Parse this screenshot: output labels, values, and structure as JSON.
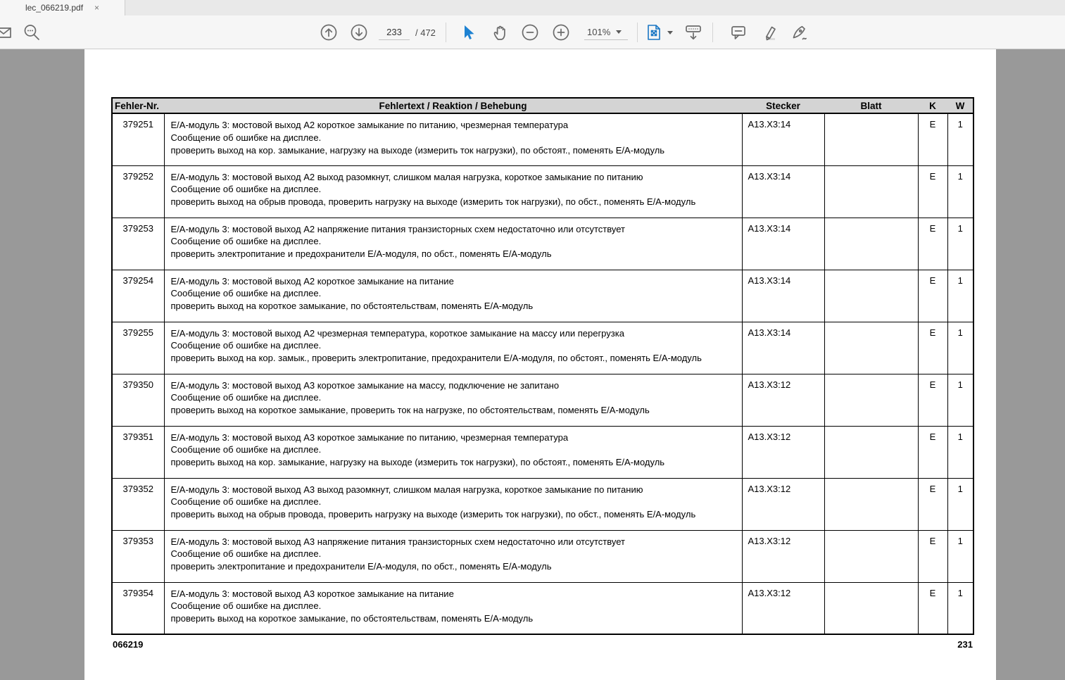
{
  "tab": {
    "title": "lec_066219.pdf",
    "close_glyph": "×"
  },
  "toolbar": {
    "page_current": "233",
    "page_total_label": "/ 472",
    "zoom_level": "101%",
    "icons": [
      "envelope-icon",
      "search-icon",
      "page-up-icon",
      "page-down-icon",
      "select-tool-icon",
      "hand-tool-icon",
      "zoom-out-icon",
      "zoom-in-icon",
      "page-fit-icon",
      "chevron-down-icon",
      "hide-toolbar-icon",
      "comment-icon",
      "highlighter-icon",
      "signature-pen-icon"
    ],
    "accent_color": "#1a77c4"
  },
  "document": {
    "table": {
      "headers": [
        "Fehler-Nr.",
        "Fehlertext / Reaktion / Behebung",
        "Stecker",
        "Blatt",
        "K",
        "W"
      ],
      "rows": [
        {
          "nr": "379251",
          "l1": "Е/А-модуль 3: мостовой выход А2 короткое замыкание по питанию, чрезмерная температура",
          "l2": "Сообщение об ошибке на дисплее.",
          "l3": "проверить выход на кор. замыкание, нагрузку на выходе (измерить ток нагрузки), по обстоят., поменять Е/А-модуль",
          "stecker": "A13.X3:14",
          "blatt": "",
          "k": "E",
          "w": "1"
        },
        {
          "nr": "379252",
          "l1": "Е/А-модуль 3: мостовой выход А2 выход разомкнут, слишком малая нагрузка, короткое замыкание по питанию",
          "l2": "Сообщение об ошибке на дисплее.",
          "l3": "проверить выход на обрыв провода, проверить нагрузку на выходе (измерить ток нагрузки), по обст., поменять Е/А-модуль",
          "stecker": "A13.X3:14",
          "blatt": "",
          "k": "E",
          "w": "1"
        },
        {
          "nr": "379253",
          "l1": "Е/А-модуль 3: мостовой выход А2 напряжение питания транзисторных схем недостаточно или отсутствует",
          "l2": "Сообщение об ошибке на дисплее.",
          "l3": "проверить электропитание и предохранители Е/А-модуля, по обст., поменять Е/А-модуль",
          "stecker": "A13.X3:14",
          "blatt": "",
          "k": "E",
          "w": "1"
        },
        {
          "nr": "379254",
          "l1": "Е/А-модуль 3: мостовой выход А2 короткое замыкание на питание",
          "l2": "Сообщение об ошибке на дисплее.",
          "l3": "проверить выход на короткое замыкание, по обстоятельствам, поменять Е/А-модуль",
          "stecker": "A13.X3:14",
          "blatt": "",
          "k": "E",
          "w": "1"
        },
        {
          "nr": "379255",
          "l1": "Е/А-модуль 3: мостовой выход А2 чрезмерная температура, короткое замыкание на массу или перегрузка",
          "l2": "Сообщение об ошибке на дисплее.",
          "l3": "проверить выход на кор. замык., проверить электропитание, предохранители Е/А-модуля, по обстоят., поменять Е/А-модуль",
          "stecker": "A13.X3:14",
          "blatt": "",
          "k": "E",
          "w": "1"
        },
        {
          "nr": "379350",
          "l1": "Е/А-модуль 3: мостовой выход А3 короткое замыкание на массу, подключение не запитано",
          "l2": "Сообщение об ошибке на дисплее.",
          "l3": "проверить выход на короткое замыкание, проверить ток на нагрузке, по обстоятельствам, поменять Е/А-модуль",
          "stecker": "A13.X3:12",
          "blatt": "",
          "k": "E",
          "w": "1"
        },
        {
          "nr": "379351",
          "l1": "Е/А-модуль 3: мостовой выход А3 короткое замыкание по питанию, чрезмерная температура",
          "l2": "Сообщение об ошибке на дисплее.",
          "l3": "проверить выход на кор. замыкание, нагрузку на выходе (измерить ток нагрузки), по обстоят., поменять Е/А-модуль",
          "stecker": "A13.X3:12",
          "blatt": "",
          "k": "E",
          "w": "1"
        },
        {
          "nr": "379352",
          "l1": "Е/А-модуль 3: мостовой выход А3 выход разомкнут, слишком малая нагрузка, короткое замыкание по питанию",
          "l2": "Сообщение об ошибке на дисплее.",
          "l3": "проверить выход на обрыв провода, проверить нагрузку на выходе (измерить ток нагрузки), по обст., поменять Е/А-модуль",
          "stecker": "A13.X3:12",
          "blatt": "",
          "k": "E",
          "w": "1"
        },
        {
          "nr": "379353",
          "l1": "Е/А-модуль 3: мостовой выход А3 напряжение питания транзисторных схем недостаточно или отсутствует",
          "l2": "Сообщение об ошибке на дисплее.",
          "l3": "проверить электропитание и предохранители Е/А-модуля, по обст., поменять Е/А-модуль",
          "stecker": "A13.X3:12",
          "blatt": "",
          "k": "E",
          "w": "1"
        },
        {
          "nr": "379354",
          "l1": "Е/А-модуль 3: мостовой выход А3 короткое замыкание на питание",
          "l2": "Сообщение об ошибке на дисплее.",
          "l3": "проверить выход на короткое замыкание, по обстоятельствам, поменять Е/А-модуль",
          "stecker": "A13.X3:12",
          "blatt": "",
          "k": "E",
          "w": "1"
        }
      ]
    },
    "footer": {
      "left": "066219",
      "right": "231"
    }
  }
}
